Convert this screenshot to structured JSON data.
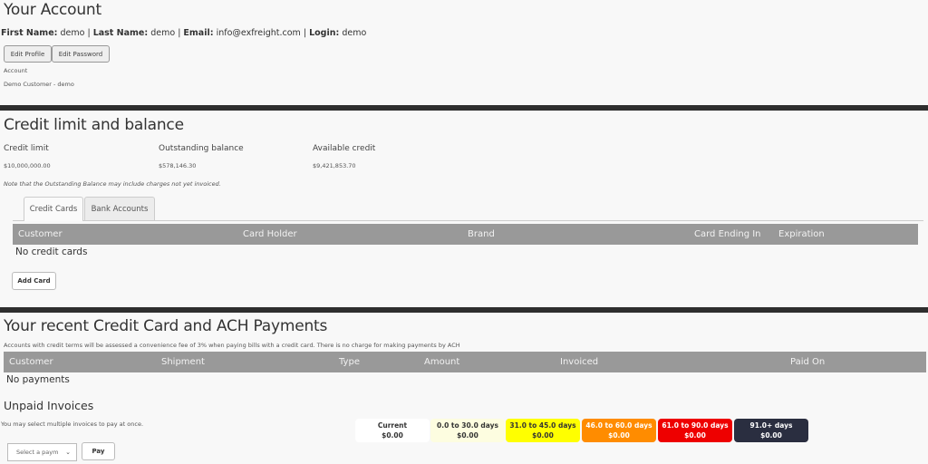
{
  "account": {
    "title": "Your Account",
    "fields": [
      {
        "label": "First Name:",
        "value": "demo"
      },
      {
        "label": "Last Name:",
        "value": "demo"
      },
      {
        "label": "Email:",
        "value": "info@exfreight.com"
      },
      {
        "label": "Login:",
        "value": "demo"
      }
    ],
    "separator": "|",
    "edit_profile_label": "Edit Profile",
    "edit_password_label": "Edit Password",
    "account_label": "Account",
    "account_value": "Demo Customer - demo"
  },
  "credit": {
    "title": "Credit limit and balance",
    "credit_limit_label": "Credit limit",
    "credit_limit_value": "$10,000,000.00",
    "outstanding_label": "Outstanding balance",
    "outstanding_value": "$578,146.30",
    "available_label": "Available credit",
    "available_value": "$9,421,853.70",
    "note": "Note that the Outstanding Balance may include charges not yet invoiced."
  },
  "tabs": [
    {
      "label": "Credit Cards",
      "active": true
    },
    {
      "label": "Bank Accounts",
      "active": false
    }
  ],
  "cards_table": {
    "columns": [
      "Customer",
      "Card Holder",
      "Brand",
      "Card Ending In",
      "Expiration"
    ],
    "empty_text": "No credit cards",
    "add_card_label": "Add Card"
  },
  "payments": {
    "title": "Your recent Credit Card and ACH Payments",
    "note": "Accounts with credit terms will be assessed a convenience fee of 3% when paying bills with a credit card. There is no charge for making payments by ACH",
    "columns": [
      "Customer",
      "Shipment",
      "Type",
      "Amount",
      "Invoiced",
      "Paid On"
    ],
    "empty_text": "No payments"
  },
  "unpaid": {
    "title": "Unpaid Invoices",
    "note": "You may select multiple invoices to pay at once.",
    "select_placeholder": "Select a paym",
    "pay_label": "Pay",
    "buckets": [
      {
        "label": "Current",
        "amount": "$0.00",
        "bg": "#ffffff",
        "fg": "#333333"
      },
      {
        "label": "0.0 to 30.0 days",
        "amount": "$0.00",
        "bg": "#fdfde0",
        "fg": "#333333"
      },
      {
        "label": "31.0 to 45.0 days",
        "amount": "$0.00",
        "bg": "#ffff00",
        "fg": "#333333"
      },
      {
        "label": "46.0 to 60.0 days",
        "amount": "$0.00",
        "bg": "#ff8c00",
        "fg": "#ffffff"
      },
      {
        "label": "61.0 to 90.0 days",
        "amount": "$0.00",
        "bg": "#ee0000",
        "fg": "#ffffff"
      },
      {
        "label": "91.0+ days",
        "amount": "$0.00",
        "bg": "#2a2e40",
        "fg": "#ffffff"
      }
    ]
  }
}
